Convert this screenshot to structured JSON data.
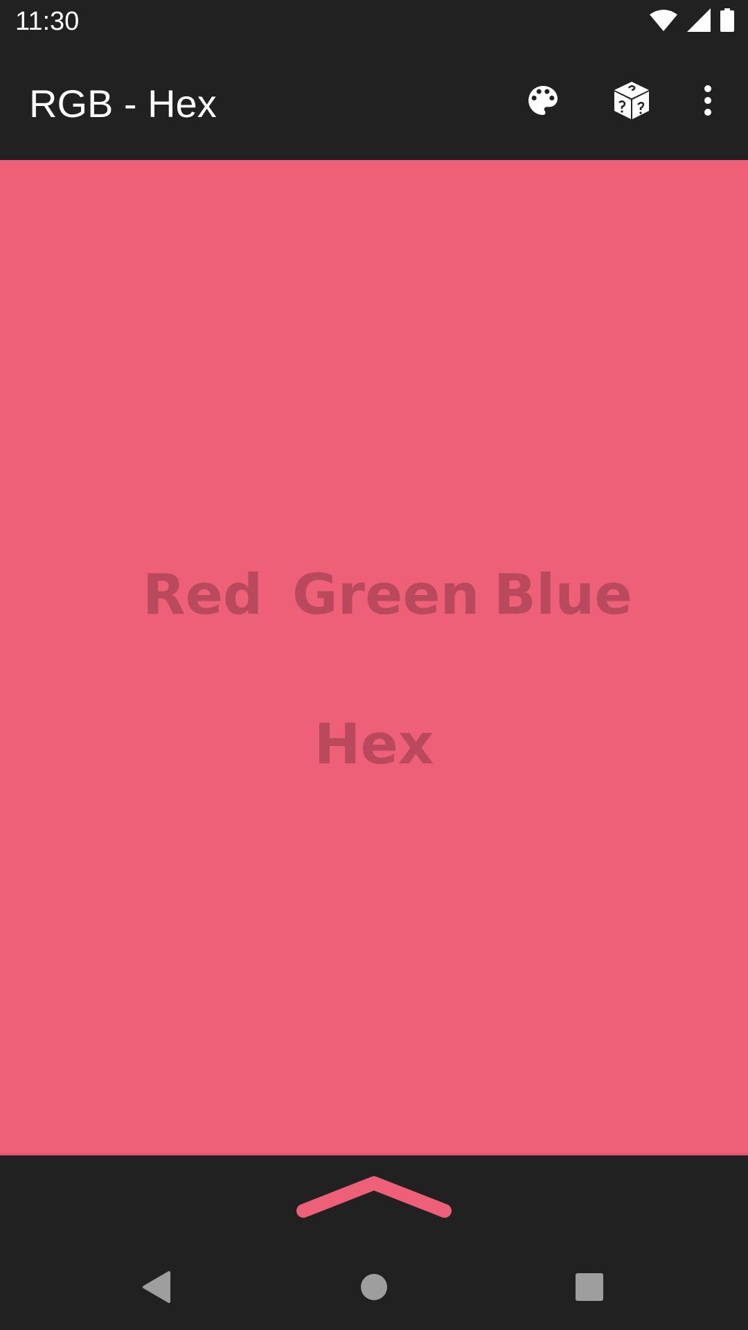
{
  "status_bar": {
    "time": "11:30",
    "icons": [
      "wifi-icon",
      "signal-icon",
      "battery-icon"
    ]
  },
  "app_bar": {
    "title": "RGB - Hex",
    "actions": [
      "palette-icon",
      "dice-icon",
      "more-vert-icon"
    ]
  },
  "color_display": {
    "background_color": "#ee6077",
    "text_color": "#b94a5e",
    "channels": [
      "Red",
      "Green",
      "Blue"
    ],
    "hex_label": "Hex"
  },
  "bottom_panel": {
    "handle_icon": "chevron-up-icon",
    "handle_color": "#ee6077"
  },
  "nav_bar": {
    "buttons": [
      "back-icon",
      "home-icon",
      "recents-icon"
    ],
    "button_color": "#9e9e9e"
  }
}
